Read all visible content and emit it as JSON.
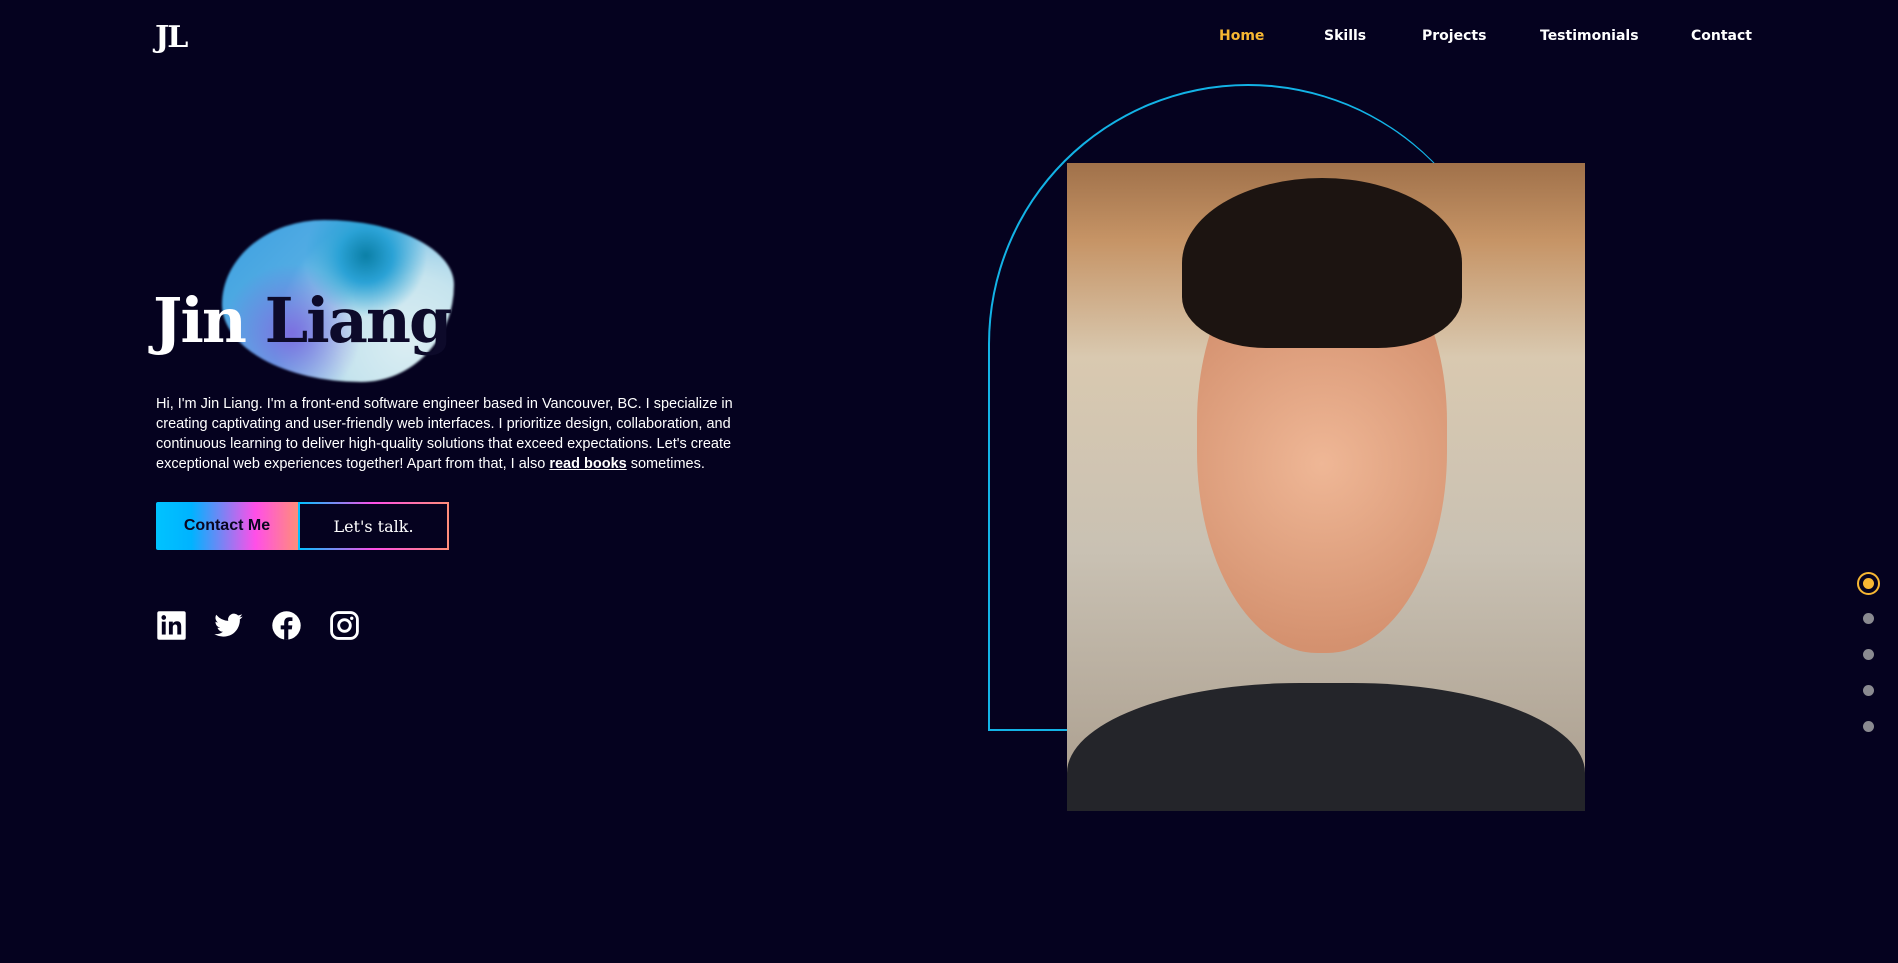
{
  "logo": "JL",
  "nav": [
    {
      "label": "Home",
      "active": true
    },
    {
      "label": "Skills"
    },
    {
      "label": "Projects"
    },
    {
      "label": "Testimonials"
    },
    {
      "label": "Contact"
    }
  ],
  "hero": {
    "first_name": "Jin",
    "last_name": "Liang",
    "intro_before": "Hi, I'm Jin Liang. I'm a front-end software engineer based in Vancouver, BC. I specialize in creating captivating and user-friendly web interfaces. I prioritize design, collaboration, and continuous learning to deliver high-quality solutions that exceed expectations. Let's create exceptional web experiences together! Apart from that, I also ",
    "intro_link": "read books",
    "intro_after": " sometimes.",
    "contact_button": "Contact Me",
    "talk_button": "Let's talk."
  },
  "social": [
    "linkedin-icon",
    "twitter-icon",
    "facebook-icon",
    "instagram-icon"
  ],
  "section_dots": {
    "count": 5,
    "active_index": 0
  },
  "colors": {
    "background": "#05021f",
    "accent": "#f7b733",
    "arch": "#13b3e6"
  }
}
